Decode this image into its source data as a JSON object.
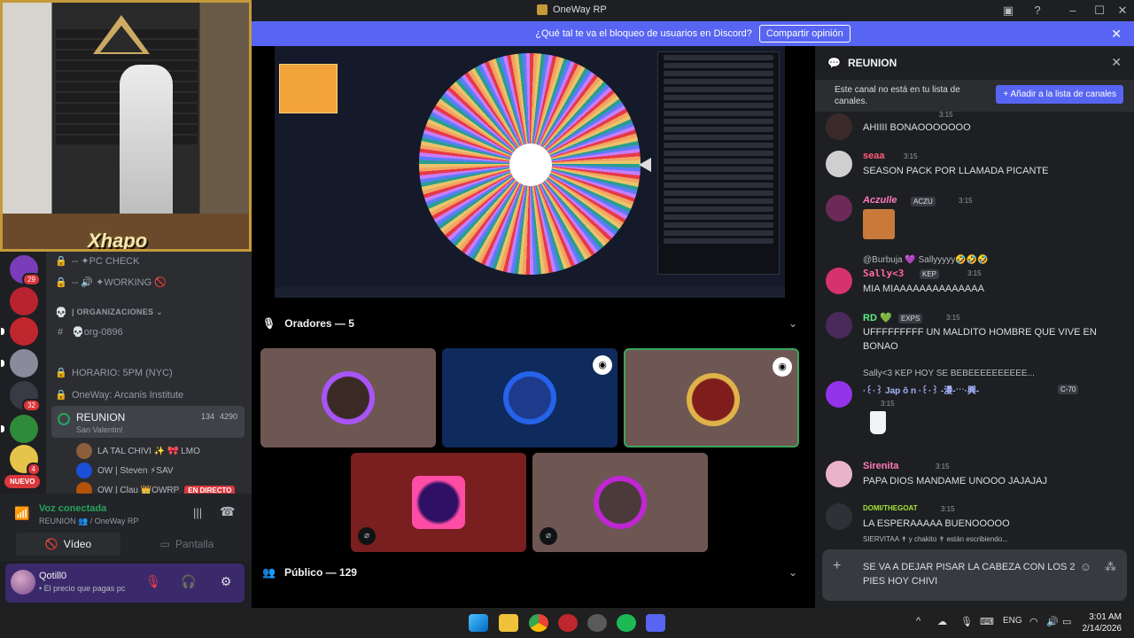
{
  "window": {
    "title": "OneWay RP"
  },
  "notice": {
    "text": "¿Qué tal te va el bloqueo de usuarios en Discord?",
    "button": "Compartir opinión"
  },
  "webcam": {
    "name": "Xhapo"
  },
  "servers": [
    {
      "badge": "29",
      "color": "#7a3cb8"
    },
    {
      "badge": "",
      "color": "#b8232f"
    },
    {
      "badge": "",
      "color": "#c0262e"
    },
    {
      "badge": "",
      "color": "#8a8a9a"
    },
    {
      "badge": "32",
      "color": "#3a3a44"
    },
    {
      "badge": "",
      "color": "#2e8b3a"
    },
    {
      "badge": "4",
      "color": "#e6c44a"
    }
  ],
  "new_badge": "NUEVO",
  "channels": [
    {
      "icon": "🔒",
      "label": "-- ✦PC CHECK"
    },
    {
      "icon": "🔒",
      "label": "-- 🔊 ✦WORKING 🚫"
    },
    {
      "icon": "💀",
      "label": "| ORGANIZACIONES ⌄",
      "category": true
    },
    {
      "icon": "#",
      "label": "💀org-0896"
    },
    {
      "icon": "🔒",
      "label": "HORARIO: 5PM (NYC)"
    },
    {
      "icon": "🔒",
      "label": "OneWay: Arcanis Institute"
    }
  ],
  "active_channel": {
    "name": "REUNION",
    "sub": "San Valentin!",
    "count_a": "134",
    "count_b": "4290"
  },
  "voice_users": [
    {
      "name": "LA TAL CHIVI ✨ 🎀 LMO",
      "live": false
    },
    {
      "name": "OW | Steven ⚡SAV",
      "live": false
    },
    {
      "name": "OW | Clau 👑OWRP",
      "live": true
    }
  ],
  "live_label": "EN DIRECTO",
  "voice": {
    "status": "Voz conectada",
    "sub": "REUNION 👥 / OneWay RP",
    "video_label": "Vídeo",
    "screen_label": "Pantalla"
  },
  "user": {
    "name": "Qotill0",
    "status": "• El precio que pagas pc"
  },
  "stage": {
    "speakers_label": "Oradores — 5",
    "audience_label": "Público — 129",
    "tiles": [
      {
        "name": "speaker-1",
        "bg": "#6e5753",
        "ring": "#a855f7"
      },
      {
        "name": "speaker-steven",
        "bg": "#0f2a5c",
        "ring": "#2563eb"
      },
      {
        "name": "speaker-clau",
        "bg": "#6e5753",
        "ring": "#e0b34a"
      },
      {
        "name": "speaker-juanx",
        "bg": "#7a1f1f",
        "ring": "#ff4da6"
      },
      {
        "name": "speaker-5",
        "bg": "#6e5753",
        "ring": "#c026d3"
      }
    ]
  },
  "chat": {
    "channel": "REUNION",
    "notice_text": "Este canal no está en tu lista de canales.",
    "notice_button": "+ Añadir a la lista de canales",
    "messages": [
      {
        "author": "",
        "time": "3:15",
        "text": "AHIIII BONAOOOOOOO",
        "color": "#f47fff"
      },
      {
        "author": "seaa",
        "time": "3:15",
        "text": "SEASON PACK POR LLAMADA PICANTE",
        "color": "#ff5c7a"
      },
      {
        "author": "Aczulle",
        "time": "3:15",
        "text": "",
        "color": "#ff7ab8",
        "tag": "ACZU"
      },
      {
        "author": "Sally<3",
        "time": "3:15",
        "text": "MIA MIAAAAAAAAAAAAAA",
        "color": "#ff6b9a",
        "tag": "KEP",
        "reply": "@Burbuja 💜 Sallyyyyy🤣🤣🤣"
      },
      {
        "author": "RD 💚",
        "time": "3:15",
        "text": "UFFFFFFFFF UN MALDITO HOMBRE QUE VIVE EN BONAO",
        "color": "#57f287",
        "tag": "EXPS"
      },
      {
        "author": "·꒰·꒱ Jap ǒ n ·꒰·꒱ -漫-ˑˑˑ·興-",
        "time": "3:15",
        "text": "",
        "color": "#a5b4fc",
        "tag": "C-70",
        "reply": "Sally<3 KEP HOY SE BEBEEEEEEEEEE..."
      },
      {
        "author": "Sirenita",
        "time": "3:15",
        "text": "PAPA DIOS MANDAME UNOOO JAJAJAJ",
        "color": "#ff7ab8"
      },
      {
        "author": "DOMI/THEGOAT",
        "time": "3:15",
        "text": "LA ESPERAAAAA BUENOOOOO",
        "color": "#a3e635"
      }
    ],
    "typing": "SIERVITAA ✝ y chakito ✝ están escribiendo...",
    "composer_value": "SE VA A DEJAR PISAR LA CABEZA CON LOS 2 PIES HOY CHIVI"
  },
  "taskbar": {
    "lang": "ENG",
    "time": "3:01 AM",
    "date": "2/14/2026"
  }
}
